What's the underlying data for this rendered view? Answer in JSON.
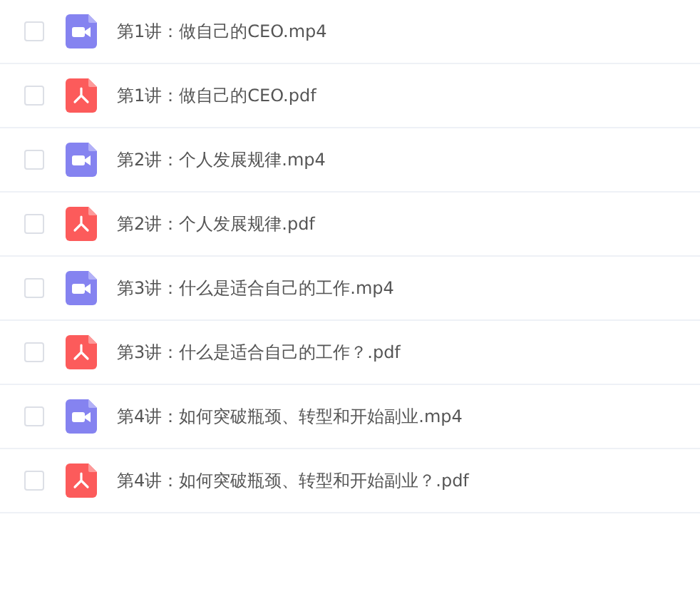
{
  "files": [
    {
      "name": "第1讲：做自己的CEO.mp4",
      "kind": "video",
      "checked": false
    },
    {
      "name": "第1讲：做自己的CEO.pdf",
      "kind": "pdf",
      "checked": false
    },
    {
      "name": "第2讲：个人发展规律.mp4",
      "kind": "video",
      "checked": false
    },
    {
      "name": "第2讲：个人发展规律.pdf",
      "kind": "pdf",
      "checked": false
    },
    {
      "name": "第3讲：什么是适合自己的工作.mp4",
      "kind": "video",
      "checked": false
    },
    {
      "name": "第3讲：什么是适合自己的工作？.pdf",
      "kind": "pdf",
      "checked": false
    },
    {
      "name": "第4讲：如何突破瓶颈、转型和开始副业.mp4",
      "kind": "video",
      "checked": false
    },
    {
      "name": "第4讲：如何突破瓶颈、转型和开始副业？.pdf",
      "kind": "pdf",
      "checked": false
    }
  ]
}
